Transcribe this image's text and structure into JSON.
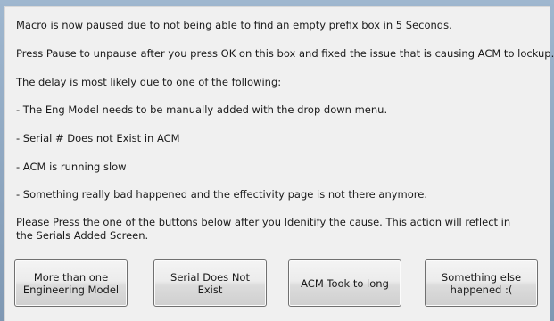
{
  "messages": {
    "line1": "Macro is now paused due to not being able to find an empty prefix box in 5 Seconds.",
    "line2": "Press Pause to unpause after you press OK on this box and fixed the issue that is causing ACM to lockup.",
    "line3": "The delay is most likely due to one of the following:",
    "reasons": [
      "- The Eng Model needs to be manually added with the drop down menu.",
      "- Serial # Does not Exist in ACM",
      "- ACM is running slow",
      "- Something really bad happened and the effectivity page is not there anymore."
    ],
    "instruction": "Please Press the one of the buttons below after you Idenitify the cause. This action will reflect in the Serials Added Screen."
  },
  "buttons": [
    {
      "label": "More than one\nEngineering Model"
    },
    {
      "label": "Serial Does Not\nExist"
    },
    {
      "label": "ACM Took to long"
    },
    {
      "label": "Something else\nhappened :("
    }
  ]
}
